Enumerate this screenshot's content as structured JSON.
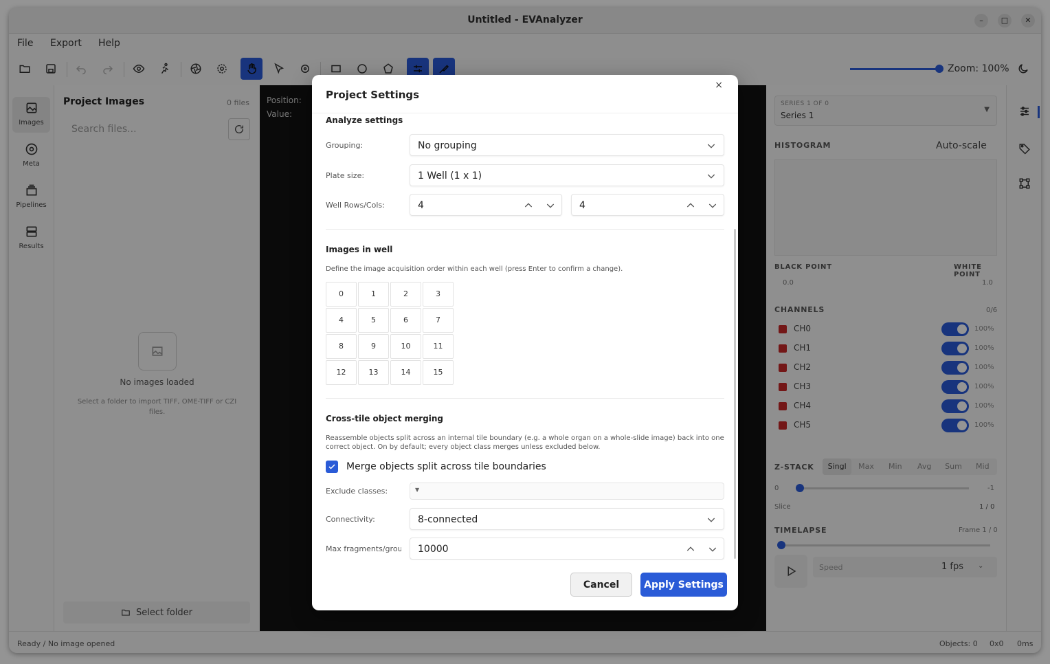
{
  "window": {
    "title": "Untitled - EVAnalyzer"
  },
  "menu": [
    "File",
    "Export",
    "Help"
  ],
  "zoom": {
    "label": "Zoom: 100%",
    "value_pct": 100
  },
  "left_rail": [
    {
      "label": "Images",
      "icon": "image-icon"
    },
    {
      "label": "Meta",
      "icon": "palette-icon"
    },
    {
      "label": "Pipelines",
      "icon": "layers-icon"
    },
    {
      "label": "Results",
      "icon": "database-icon"
    }
  ],
  "project": {
    "title": "Project Images",
    "count": "0 files",
    "search_placeholder": "Search files...",
    "empty_title": "No images loaded",
    "empty_desc": "Select a folder to import TIFF, OME-TIFF or CZI files.",
    "select_folder": "Select folder"
  },
  "viewer": {
    "position_label": "Position:",
    "value_label": "Value:"
  },
  "right_panel": {
    "series_label": "SERIES 1 OF 0",
    "series_value": "Series 1",
    "histogram": "HISTOGRAM",
    "autoscale": "Auto-scale",
    "black_point_label": "BLACK POINT",
    "white_point_label": "WHITE POINT",
    "black_point": "0.0",
    "white_point": "1.0",
    "channels_label": "CHANNELS",
    "channels_count": "0/6",
    "channels": [
      {
        "name": "CH0",
        "pct": "100%"
      },
      {
        "name": "CH1",
        "pct": "100%"
      },
      {
        "name": "CH2",
        "pct": "100%"
      },
      {
        "name": "CH3",
        "pct": "100%"
      },
      {
        "name": "CH4",
        "pct": "100%"
      },
      {
        "name": "CH5",
        "pct": "100%"
      }
    ],
    "zstack_label": "Z-STACK",
    "zstack_modes": [
      "Singl",
      "Max",
      "Min",
      "Avg",
      "Sum",
      "Mid"
    ],
    "zstack_min": "0",
    "zstack_max": "-1",
    "slice_label": "Slice",
    "slice_value": "1 / 0",
    "timelapse_label": "TIMELAPSE",
    "frame_label": "Frame 1 / 0",
    "speed_label": "Speed",
    "speed_value": "1 fps"
  },
  "status": {
    "left": "Ready / No image opened",
    "objects": "Objects: 0",
    "size": "0x0",
    "time": "0ms"
  },
  "dialog": {
    "title": "Project Settings",
    "close": "×",
    "analyze_title": "Analyze settings",
    "grouping_label": "Grouping:",
    "grouping_value": "No grouping",
    "plate_label": "Plate size:",
    "plate_value": "1 Well (1 x 1)",
    "wellrc_label": "Well Rows/Cols:",
    "well_rows": "4",
    "well_cols": "4",
    "images_title": "Images in well",
    "images_desc": "Define the image acquisition order within each well (press Enter to confirm a change).",
    "grid": [
      "0",
      "1",
      "2",
      "3",
      "4",
      "5",
      "6",
      "7",
      "8",
      "9",
      "10",
      "11",
      "12",
      "13",
      "14",
      "15"
    ],
    "merge_title": "Cross-tile object merging",
    "merge_desc": "Reassemble objects split across an internal tile boundary (e.g. a whole organ on a whole-slide image) back into one correct object. On by default; every object class merges unless excluded below.",
    "merge_checkbox": "Merge objects split across tile boundaries",
    "merge_checked": true,
    "exclude_label": "Exclude classes:",
    "connectivity_label": "Connectivity:",
    "connectivity_value": "8-connected",
    "maxfrag_label": "Max fragments/group",
    "maxfrag_value": "10000",
    "cancel": "Cancel",
    "apply": "Apply Settings"
  }
}
